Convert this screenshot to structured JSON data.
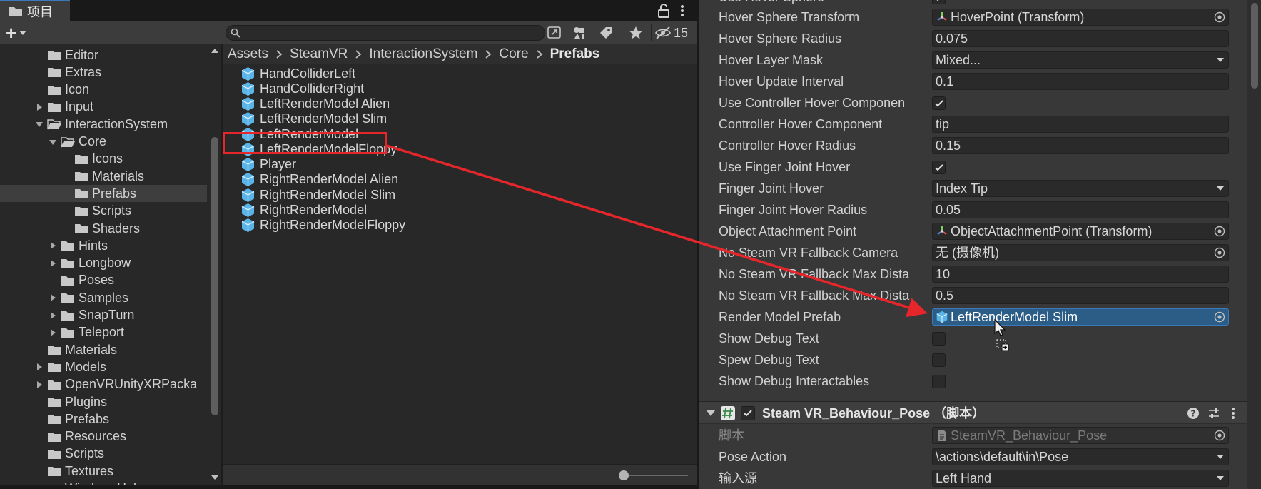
{
  "project_tab": {
    "title": "项目",
    "hidden_count": "15",
    "search_placeholder": "",
    "add_label": "+"
  },
  "tree": [
    {
      "label": "Editor",
      "depth": 3,
      "arrow": "none",
      "open": false
    },
    {
      "label": "Extras",
      "depth": 3,
      "arrow": "none",
      "open": false
    },
    {
      "label": "Icon",
      "depth": 3,
      "arrow": "none",
      "open": false
    },
    {
      "label": "Input",
      "depth": 3,
      "arrow": "right",
      "open": false
    },
    {
      "label": "InteractionSystem",
      "depth": 3,
      "arrow": "down",
      "open": true
    },
    {
      "label": "Core",
      "depth": 4,
      "arrow": "down",
      "open": true
    },
    {
      "label": "Icons",
      "depth": 5,
      "arrow": "none",
      "open": false
    },
    {
      "label": "Materials",
      "depth": 5,
      "arrow": "none",
      "open": false
    },
    {
      "label": "Prefabs",
      "depth": 5,
      "arrow": "none",
      "open": false,
      "selected": true
    },
    {
      "label": "Scripts",
      "depth": 5,
      "arrow": "none",
      "open": false
    },
    {
      "label": "Shaders",
      "depth": 5,
      "arrow": "none",
      "open": false
    },
    {
      "label": "Hints",
      "depth": 4,
      "arrow": "right",
      "open": false
    },
    {
      "label": "Longbow",
      "depth": 4,
      "arrow": "right",
      "open": false
    },
    {
      "label": "Poses",
      "depth": 4,
      "arrow": "none",
      "open": false
    },
    {
      "label": "Samples",
      "depth": 4,
      "arrow": "right",
      "open": false
    },
    {
      "label": "SnapTurn",
      "depth": 4,
      "arrow": "right",
      "open": false
    },
    {
      "label": "Teleport",
      "depth": 4,
      "arrow": "right",
      "open": false
    },
    {
      "label": "Materials",
      "depth": 3,
      "arrow": "none",
      "open": false
    },
    {
      "label": "Models",
      "depth": 3,
      "arrow": "right",
      "open": false
    },
    {
      "label": "OpenVRUnityXRPacka",
      "depth": 3,
      "arrow": "right",
      "open": false
    },
    {
      "label": "Plugins",
      "depth": 3,
      "arrow": "none",
      "open": false
    },
    {
      "label": "Prefabs",
      "depth": 3,
      "arrow": "none",
      "open": false
    },
    {
      "label": "Resources",
      "depth": 3,
      "arrow": "none",
      "open": false
    },
    {
      "label": "Scripts",
      "depth": 3,
      "arrow": "none",
      "open": false
    },
    {
      "label": "Textures",
      "depth": 3,
      "arrow": "none",
      "open": false
    },
    {
      "label": "WindowsHelper",
      "depth": 3,
      "arrow": "none",
      "open": false
    }
  ],
  "breadcrumb": [
    "Assets",
    "SteamVR",
    "InteractionSystem",
    "Core",
    "Prefabs"
  ],
  "files": [
    "HandColliderLeft",
    "HandColliderRight",
    "LeftRenderModel Alien",
    "LeftRenderModel Slim",
    "LeftRenderModel",
    "LeftRenderModelFloppy",
    "Player",
    "RightRenderModel Alien",
    "RightRenderModel Slim",
    "RightRenderModel",
    "RightRenderModelFloppy"
  ],
  "highlighted_file": "LeftRenderModel",
  "inspector": {
    "top_clipped_label": "Use Hover Sphere",
    "properties": [
      {
        "label": "Hover Sphere Transform",
        "type": "object",
        "value": "HoverPoint (Transform)",
        "icon": "transform-icon"
      },
      {
        "label": "Hover Sphere Radius",
        "type": "text",
        "value": "0.075"
      },
      {
        "label": "Hover Layer Mask",
        "type": "dropdown",
        "value": "Mixed..."
      },
      {
        "label": "Hover Update Interval",
        "type": "text",
        "value": "0.1"
      },
      {
        "label": "Use Controller Hover Componen",
        "type": "check",
        "checked": true
      },
      {
        "label": "Controller Hover Component",
        "type": "text",
        "value": "tip"
      },
      {
        "label": "Controller Hover Radius",
        "type": "text",
        "value": "0.15"
      },
      {
        "label": "Use Finger Joint Hover",
        "type": "check",
        "checked": true
      },
      {
        "label": "Finger Joint Hover",
        "type": "dropdown",
        "value": "Index Tip"
      },
      {
        "label": "Finger Joint Hover Radius",
        "type": "text",
        "value": "0.05"
      },
      {
        "label": "Object Attachment Point",
        "type": "object",
        "value": "ObjectAttachmentPoint (Transform)",
        "icon": "transform-icon"
      },
      {
        "label": "No Steam VR Fallback Camera",
        "type": "object",
        "value": "无 (摄像机)",
        "icon": ""
      },
      {
        "label": "No Steam VR Fallback Max Dista",
        "type": "text",
        "value": "10"
      },
      {
        "label": "No Steam VR Fallback Max Dista",
        "type": "text",
        "value": "0.5"
      },
      {
        "label": "Render Model Prefab",
        "type": "object",
        "value": "LeftRenderModel Slim",
        "icon": "prefab-icon",
        "selected": true
      },
      {
        "label": "Show Debug Text",
        "type": "check",
        "checked": false
      },
      {
        "label": "Spew Debug Text",
        "type": "check",
        "checked": false
      },
      {
        "label": "Show Debug Interactables",
        "type": "check",
        "checked": false
      }
    ],
    "component": {
      "title": "Steam VR_Behaviour_Pose （脚本）",
      "enabled": true
    },
    "component_properties": [
      {
        "label": "脚本",
        "type": "object",
        "value": "SteamVR_Behaviour_Pose",
        "icon": "script-icon",
        "disabled": true
      },
      {
        "label": "Pose Action",
        "type": "dropdown",
        "value": "\\actions\\default\\in\\Pose"
      },
      {
        "label": "输入源",
        "type": "dropdown",
        "value": "Left Hand"
      }
    ]
  },
  "colors": {
    "annotation_red": "#e5262b",
    "selection_blue": "#2c5d87",
    "prefab_blue": "#5ab4e8"
  }
}
